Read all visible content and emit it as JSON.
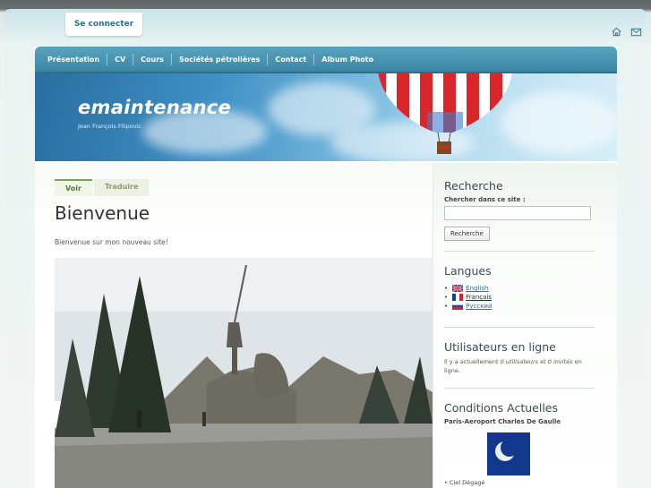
{
  "header": {
    "login_label": "Se connecter",
    "icons": [
      "home-icon",
      "mail-icon"
    ]
  },
  "nav": {
    "items": [
      "Présentation",
      "CV",
      "Cours",
      "Sociétés pétrolières",
      "Contact",
      "Album Photo"
    ]
  },
  "banner": {
    "site_name": "emaintenance",
    "slogan": "Jean François Filipovic"
  },
  "content": {
    "tabs": [
      "Voir",
      "Traduire"
    ],
    "title": "Bienvenue",
    "intro": "Bienvenue sur mon nouveau site!"
  },
  "sidebar": {
    "search": {
      "title": "Recherche",
      "label": "Chercher dans ce site :",
      "button": "Recherche"
    },
    "languages": {
      "title": "Langues",
      "items": [
        "English",
        "Français",
        "Русский"
      ]
    },
    "online": {
      "title": "Utilisateurs en ligne",
      "text_prefix": "Il y a actuellement",
      "users": "0 utilisateurs",
      "middle": "et",
      "guests": "0 invités",
      "text_suffix": "en ligne."
    },
    "weather": {
      "title": "Conditions Actuelles",
      "location": "Paris-Aeroport Charles De Gaulle",
      "condition": "Ciel Dégagé"
    }
  },
  "colors": {
    "nav_bg": "#3a87a5",
    "link": "#2e6fa0",
    "login_text": "#2f6f8a",
    "weather_bg": "#12388d"
  }
}
